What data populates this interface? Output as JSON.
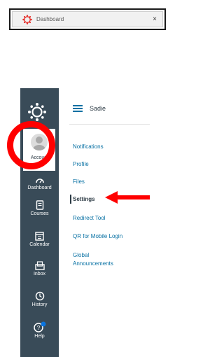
{
  "browser_tab": {
    "title": "Dashboard",
    "close_glyph": "×",
    "icon": "canvas-logo-icon",
    "accent_color": "#e4302c"
  },
  "global_nav": {
    "background": "#394b58",
    "account": {
      "label": "Account",
      "icon": "avatar-icon"
    },
    "items": [
      {
        "label": "Dashboard",
        "icon": "dashboard-icon"
      },
      {
        "label": "Courses",
        "icon": "courses-icon"
      },
      {
        "label": "Calendar",
        "icon": "calendar-icon"
      },
      {
        "label": "Inbox",
        "icon": "inbox-icon"
      },
      {
        "label": "History",
        "icon": "history-icon"
      },
      {
        "label": "Help",
        "icon": "help-icon"
      }
    ]
  },
  "account_tray": {
    "user_name": "Sadie",
    "links": [
      {
        "label": "Notifications",
        "active": false
      },
      {
        "label": "Profile",
        "active": false
      },
      {
        "label": "Files",
        "active": false
      },
      {
        "label": "Settings",
        "active": true
      },
      {
        "label": "Redirect Tool",
        "active": false
      },
      {
        "label": "QR for Mobile Login",
        "active": false
      },
      {
        "label": "Global",
        "active": false
      },
      {
        "label": "Announcements",
        "active": false
      }
    ],
    "link_color": "#0770a3"
  },
  "annotations": {
    "highlight_color": "#ff0000"
  }
}
